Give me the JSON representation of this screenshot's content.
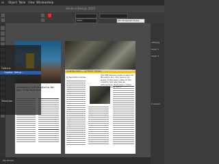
{
  "menubar": {
    "items": [
      "ss",
      "Object",
      "Table",
      "View",
      "Window",
      "Help"
    ]
  },
  "titlebar": {
    "title": "Adobe InDesign 2020"
  },
  "controlbar": {
    "style_field": "[No Paragraph Style]",
    "percent": "100%"
  },
  "overlay_panel": {
    "items": [
      "",
      "",
      "",
      "",
      "",
      "Options",
      "Caption Setup...",
      "",
      "",
      "",
      "",
      "Selection"
    ],
    "highlighted": "Caption Setup..."
  },
  "left_page": {
    "pull_quote": "of amazing cafés located in the ome of the best food.",
    "colors": {
      "photo_top": "#1d5a86",
      "yellow": "#f2c21b"
    }
  },
  "right_page": {
    "headline": "The Brickhouse Café located in Brooklyn not only serves up some of the best coffee in the country, but also has an atmosphere that keeps coffee lovers coming back.",
    "subhead": "HAUNTING BREW — COFFEE BY THE SEA",
    "by_line": "By Samantha Coleman",
    "colors": {
      "accent": "#f2c21b"
    }
  },
  "right_panel": {
    "items": [
      "",
      "",
      "",
      "",
      "",
      "cafe.jpg",
      "Layer 1",
      "Layer 2"
    ],
    "footer": "2 Layers"
  },
  "statusbar": {
    "text": "No errors"
  }
}
